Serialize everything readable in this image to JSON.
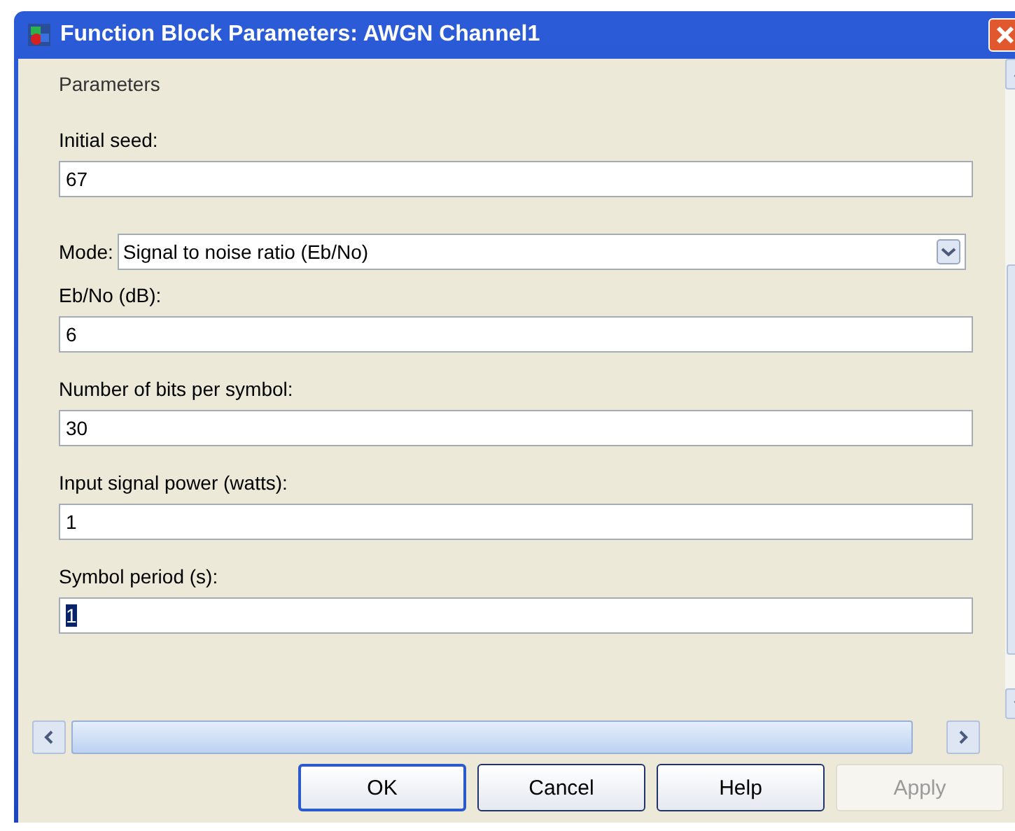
{
  "window": {
    "title": "Function Block Parameters: AWGN Channel1"
  },
  "group": {
    "title": "Parameters"
  },
  "fields": [
    {
      "kind": "text",
      "label": "Initial seed:",
      "value": "67"
    },
    {
      "kind": "dropdown",
      "label": "Mode:",
      "value": "Signal to noise ratio  (Eb/No)"
    },
    {
      "kind": "text",
      "label": "Eb/No (dB):",
      "value": "6"
    },
    {
      "kind": "text",
      "label": "Number of bits per symbol:",
      "value": "30"
    },
    {
      "kind": "text",
      "label": "Input signal power (watts):",
      "value": "1"
    },
    {
      "kind": "text",
      "label": "Symbol period (s):",
      "value": "1",
      "highlighted": true
    }
  ],
  "buttons": [
    {
      "label": "OK",
      "disabled": false,
      "default": true
    },
    {
      "label": "Cancel",
      "disabled": false,
      "default": false
    },
    {
      "label": "Help",
      "disabled": false,
      "default": false
    },
    {
      "label": "Apply",
      "disabled": true,
      "default": false
    }
  ]
}
